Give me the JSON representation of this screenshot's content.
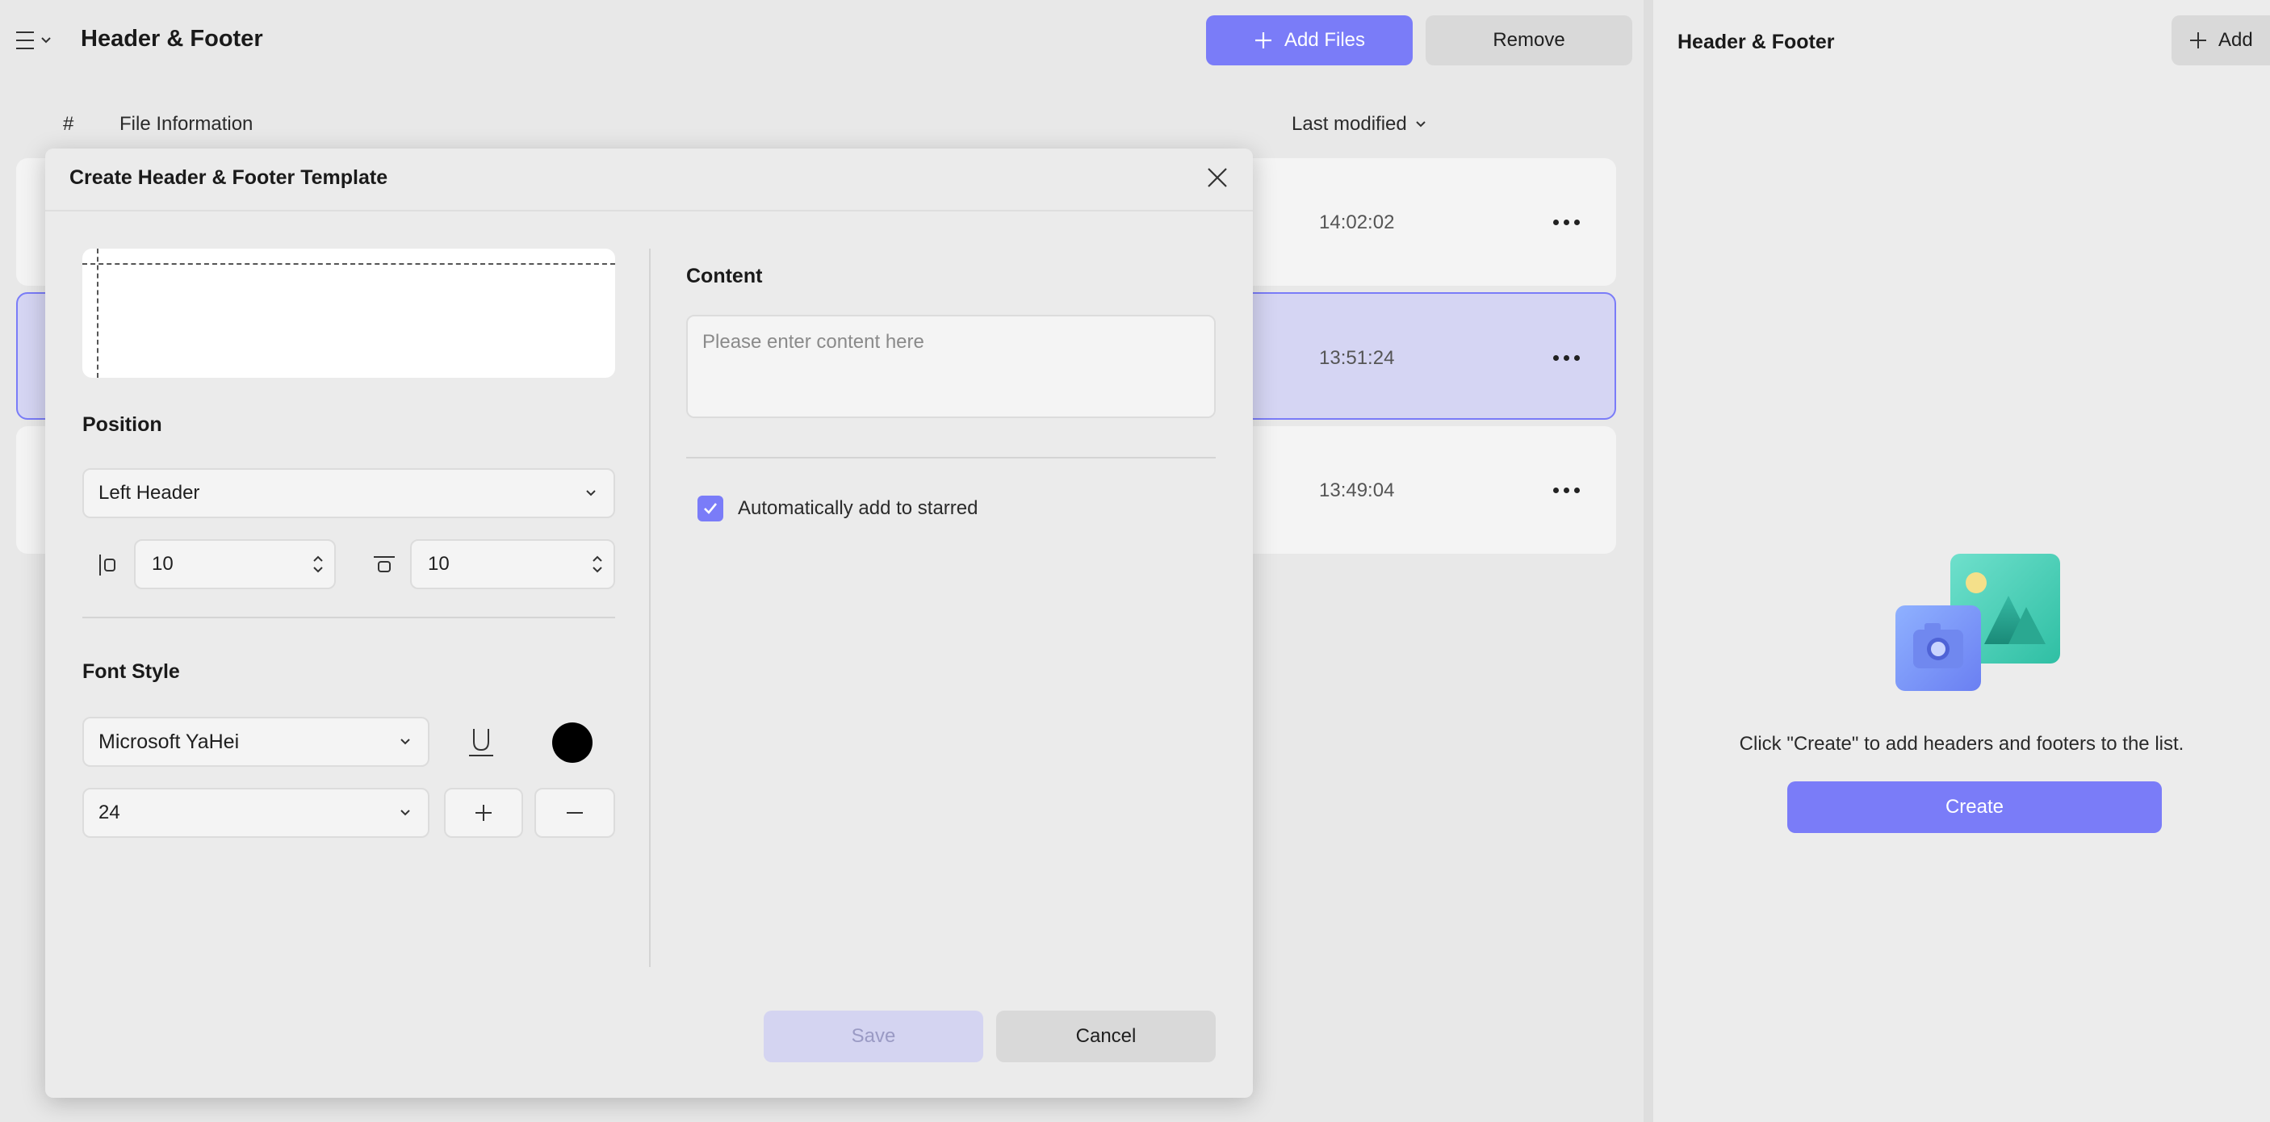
{
  "main": {
    "title": "Header & Footer",
    "add_files_label": "Add Files",
    "remove_label": "Remove",
    "columns": {
      "number": "#",
      "file_information": "File Information",
      "last_modified": "Last modified"
    },
    "rows": [
      {
        "time": "14:02:02",
        "selected": false
      },
      {
        "time": "13:51:24",
        "selected": true
      },
      {
        "time": "13:49:04",
        "selected": false
      }
    ]
  },
  "right_panel": {
    "title": "Header & Footer",
    "add_label": "Add",
    "empty_text": "Click \"Create\" to add headers and footers to the list.",
    "create_label": "Create"
  },
  "modal": {
    "title": "Create Header & Footer Template",
    "position_label": "Position",
    "position_value": "Left Header",
    "margin_left_value": "10",
    "margin_top_value": "10",
    "font_style_label": "Font Style",
    "font_family_value": "Microsoft YaHei",
    "font_size_value": "24",
    "font_color": "#000000",
    "content_label": "Content",
    "content_placeholder": "Please enter content here",
    "content_value": "",
    "auto_star_label": "Automatically add to starred",
    "auto_star_checked": true,
    "save_label": "Save",
    "cancel_label": "Cancel"
  },
  "colors": {
    "accent": "#7a7cf8",
    "selected_row": "#d5d5f3",
    "save_disabled": "#d4d4f1"
  },
  "icons": {
    "menu": "menu-icon",
    "chevron": "chevron-down-icon",
    "plus": "plus-icon",
    "more": "more-icon",
    "close": "close-icon",
    "underline": "underline-icon",
    "minus": "minus-icon",
    "check": "check-icon",
    "illustration": "image-camera-illustration"
  }
}
